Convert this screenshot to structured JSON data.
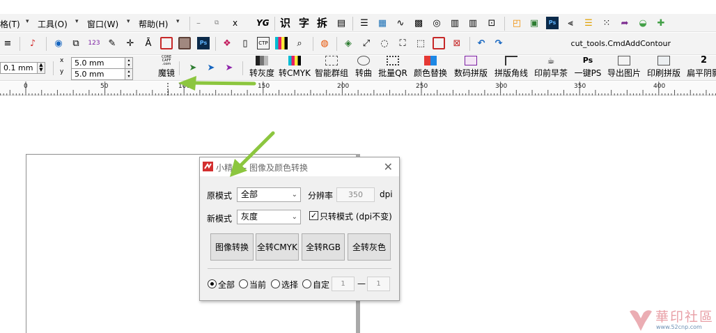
{
  "menu": {
    "items": [
      {
        "label": "格(T)"
      },
      {
        "label": "工具(O)"
      },
      {
        "label": "窗口(W)"
      },
      {
        "label": "帮助(H)"
      }
    ],
    "window_controls": {
      "minimize": "–",
      "restore": "⧉",
      "close": "x"
    },
    "text_glyphs": [
      "YG",
      "识",
      "字",
      "拆"
    ]
  },
  "toolbar2": {
    "command_label": "cut_tools.CmdAddContour",
    "icons": [
      "layer-icon",
      "logo-icon",
      "users-icon",
      "register-icon",
      "numbers-icon",
      "pen-icon",
      "crosshair-icon",
      "text-frame-icon",
      "rect-icon",
      "rect-filled-icon",
      "photoshop-icon",
      "palette-icon",
      "book-icon",
      "ctp-icon",
      "color-bars-icon",
      "zoom-icon",
      "stamp-icon",
      "trim-icon",
      "expand-icon",
      "target-icon",
      "crop-icon",
      "box-icon",
      "cross-box-icon",
      "undo-icon",
      "redo-icon"
    ]
  },
  "toolbar3": {
    "nudge_field": "0.1 mm",
    "x_field": "5.0 mm",
    "y_field": "5.0 mm",
    "x_label": "x",
    "y_label": "y",
    "buttons": [
      {
        "label": "魔镜"
      },
      {
        "label": "转灰度"
      },
      {
        "label": "转CMYK"
      },
      {
        "label": "智能群组"
      },
      {
        "label": "转曲"
      },
      {
        "label": "批量QR"
      },
      {
        "label": "颜色替换"
      },
      {
        "label": "数码拼版"
      },
      {
        "label": "拼版角线"
      },
      {
        "label": "印前早茶"
      },
      {
        "label": "一键PS"
      },
      {
        "label": "导出图片"
      },
      {
        "label": "印刷拼版"
      },
      {
        "label": "扁平阴影"
      }
    ],
    "logo_text": "CORE CAFF .com"
  },
  "ruler": {
    "ticks": [
      "0",
      "50",
      "100",
      "150",
      "200",
      "250",
      "300",
      "350",
      "400"
    ]
  },
  "dialog": {
    "title": "小精灵 - 图像及颜色转换",
    "source_mode_label": "原模式",
    "source_mode_value": "全部",
    "resolution_label": "分辨率",
    "resolution_value": "350",
    "resolution_unit": "dpi",
    "new_mode_label": "新模式",
    "new_mode_value": "灰度",
    "mode_only_checked": true,
    "mode_only_label": "只转模式 (dpi不变)",
    "buttons": {
      "image_convert": "图像转换",
      "all_cmyk": "全转CMYK",
      "all_rgb": "全转RGB",
      "all_gray": "全转灰色"
    },
    "scope": {
      "all": "全部",
      "current": "当前",
      "selection": "选择",
      "custom": "自定",
      "selected": "all",
      "range_from": "1",
      "range_sep": "—",
      "range_to": "1"
    }
  },
  "watermark": {
    "text": "華印社區",
    "url": "www.52cnp.com"
  },
  "colors": {
    "arrow_green": "#8cc63f",
    "toolbar_bg": "#f3f3f3",
    "dialog_bg": "#f0f0f0"
  }
}
